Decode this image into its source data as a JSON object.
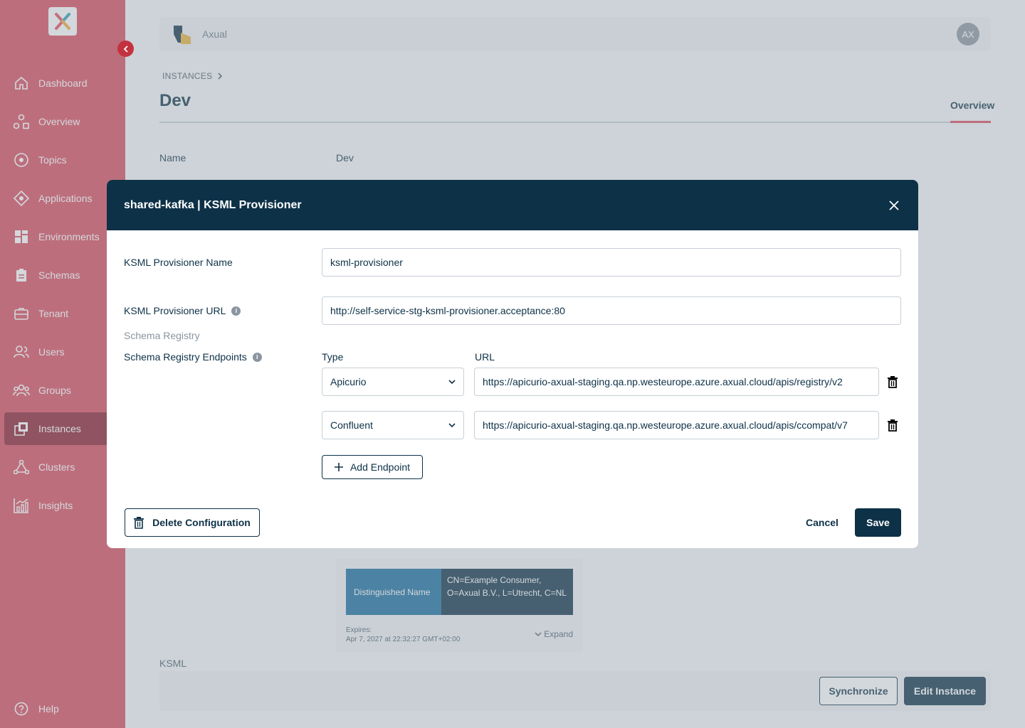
{
  "sidebar": {
    "items": [
      {
        "label": "Dashboard",
        "icon": "home-icon"
      },
      {
        "label": "Overview",
        "icon": "overview-icon"
      },
      {
        "label": "Topics",
        "icon": "topic-icon"
      },
      {
        "label": "Applications",
        "icon": "applications-icon"
      },
      {
        "label": "Environments",
        "icon": "grid-icon"
      },
      {
        "label": "Schemas",
        "icon": "clipboard-icon"
      },
      {
        "label": "Tenant",
        "icon": "briefcase-icon"
      },
      {
        "label": "Users",
        "icon": "users-icon"
      },
      {
        "label": "Groups",
        "icon": "groups-icon"
      },
      {
        "label": "Instances",
        "icon": "instances-icon",
        "active": true
      },
      {
        "label": "Clusters",
        "icon": "clusters-icon"
      },
      {
        "label": "Insights",
        "icon": "insights-icon"
      }
    ],
    "help_label": "Help"
  },
  "topbar": {
    "org_name": "Axual",
    "avatar_initials": "AX"
  },
  "breadcrumb": {
    "item": "INSTANCES"
  },
  "page": {
    "title": "Dev",
    "tab": "Overview",
    "name_label": "Name",
    "name_value": "Dev"
  },
  "certificate": {
    "key": "Distinguished Name",
    "value": "CN=Example Consumer, O=Axual B.V., L=Utrecht, C=NL",
    "expires_label": "Expires:",
    "expires_value": "Apr 7, 2027 at 22:32:27 GMT+02:00",
    "expand_label": "Expand"
  },
  "ksml_section": {
    "label": "KSML",
    "synchronize_label": "Synchronize",
    "edit_label": "Edit Instance"
  },
  "modal": {
    "title": "shared-kafka | KSML Provisioner",
    "name_label": "KSML Provisioner Name",
    "name_value": "ksml-provisioner",
    "url_label": "KSML Provisioner URL",
    "url_value": "http://self-service-stg-ksml-provisioner.acceptance:80",
    "schema_registry_heading": "Schema Registry",
    "endpoints_label": "Schema Registry Endpoints",
    "type_header": "Type",
    "url_header": "URL",
    "endpoints": [
      {
        "type": "Apicurio",
        "url": "https://apicurio-axual-staging.qa.np.westeurope.azure.axual.cloud/apis/registry/v2"
      },
      {
        "type": "Confluent",
        "url": "https://apicurio-axual-staging.qa.np.westeurope.azure.axual.cloud/apis/ccompat/v7"
      }
    ],
    "add_endpoint_label": "Add Endpoint",
    "delete_label": "Delete Configuration",
    "cancel_label": "Cancel",
    "save_label": "Save"
  },
  "colors": {
    "sidebar": "#d9495a",
    "sidebar_active": "#8c1b2b",
    "primary": "#0d3147",
    "accent": "#d9495a"
  }
}
